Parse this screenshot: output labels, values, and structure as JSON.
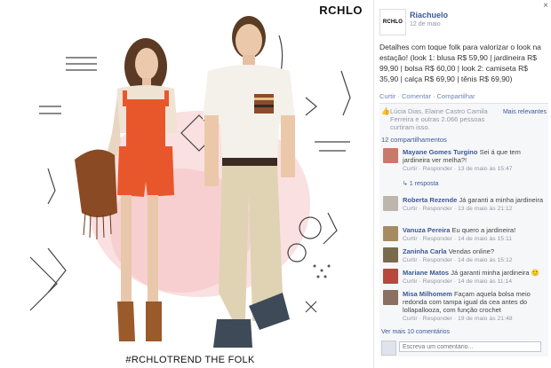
{
  "photo": {
    "brand": "RCHLO",
    "hashtag": "#RCHLOTREND THE FOLK"
  },
  "panel": {
    "close_label": "×",
    "page_avatar_text": "RCHLO",
    "page_name": "Riachuelo",
    "post_date": "12 de maio",
    "caption": "Detalhes com toque folk para valorizar o look na estação! (look 1: blusa R$ 59,90 | jardineira R$ 99,90 | bolsa R$ 60,00 | look 2: camiseta R$ 35,90 | calça R$ 69,90 | tênis R$ 69,90)",
    "actions": {
      "like": "Curtir",
      "comment": "Comentar",
      "share": "Compartilhar"
    },
    "likes_text": "Lúcia Dias, Elaine Castro Camila Ferreira e outras 2.066 pessoas curtiram isso.",
    "relevance": "Mais relevantes",
    "shares": "12 compartilhamentos",
    "comments": [
      {
        "name": "Mayane Gomes Turgino",
        "text": "Sei á que tem jardineira ver melha?!",
        "meta": "Curtir · Responder · 13 de maio às 15:47",
        "avatar_color": "#c87a6a"
      },
      {
        "name": "Roberta Rezende",
        "text": "Já garanti a minha jardineira",
        "meta": "Curtir · Responder · 13 de maio às 21:12",
        "avatar_color": "#bdb6ad"
      },
      {
        "name": "Vanuza Pereira",
        "text": "Eu quero a jardineira!",
        "meta": "Curtir · Responder · 14 de maio às 15:11",
        "avatar_color": "#a68b62"
      },
      {
        "name": "Zaninha Carla",
        "text": "Vendas online?",
        "meta": "Curtir · Responder · 14 de maio às 15:12",
        "avatar_color": "#7a6a4c"
      },
      {
        "name": "Mariane Matos",
        "text": "Já garanti minha jardineira 🙂",
        "meta": "Curtir · Responder · 14 de maio às 11:14",
        "avatar_color": "#b6483e"
      },
      {
        "name": "Misa Milhomem",
        "text": "Façam aquela bolsa meio redonda com tampa igual da cea antes do lollapallooza, com função crochet",
        "meta": "Curtir · Responder · 19 de maio às 21:48",
        "avatar_color": "#8a7060"
      }
    ],
    "reply_link": "↳ 1 resposta",
    "more_comments": "Ver mais 10 comentários",
    "write_placeholder": "Escreva um comentário..."
  },
  "colors": {
    "accent": "#3b5998",
    "overall_orange": "#e8572b"
  }
}
